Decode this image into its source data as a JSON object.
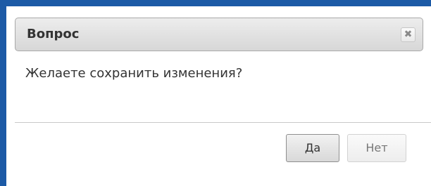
{
  "dialog": {
    "title": "Вопрос",
    "close_icon_glyph": "✖",
    "message": "Желаете сохранить изменения?",
    "buttons": {
      "yes_label": "Да",
      "no_label": "Нет"
    }
  },
  "colors": {
    "frame_accent": "#1c5aa6",
    "titlebar_bg": "#e3e3e3",
    "text": "#333333"
  }
}
